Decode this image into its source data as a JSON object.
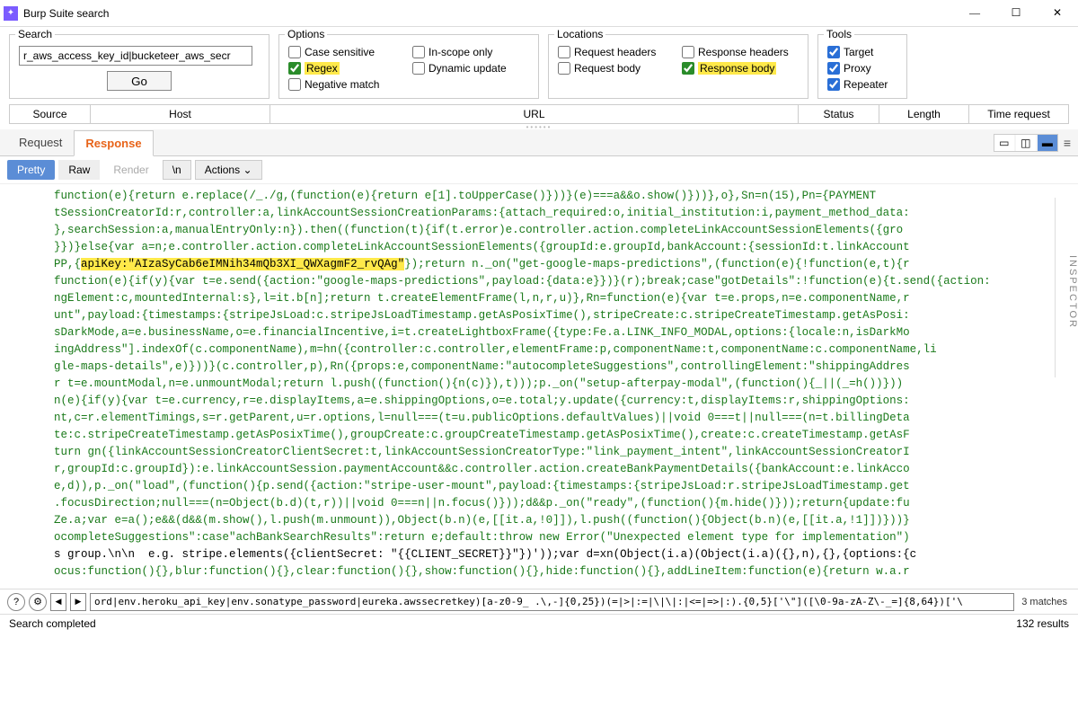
{
  "window": {
    "title": "Burp Suite search",
    "icon_glyph": "✦"
  },
  "search": {
    "legend": "Search",
    "value": "r_aws_access_key_id|bucketeer_aws_secr",
    "go_label": "Go"
  },
  "options": {
    "legend": "Options",
    "case_sensitive": "Case sensitive",
    "regex": "Regex",
    "negative_match": "Negative match",
    "in_scope_only": "In-scope only",
    "dynamic_update": "Dynamic update",
    "checked": {
      "case_sensitive": false,
      "regex": true,
      "negative_match": false,
      "in_scope_only": false,
      "dynamic_update": false
    }
  },
  "locations": {
    "legend": "Locations",
    "request_headers": "Request headers",
    "request_body": "Request body",
    "response_headers": "Response headers",
    "response_body": "Response body",
    "checked": {
      "request_headers": false,
      "request_body": false,
      "response_headers": false,
      "response_body": true
    }
  },
  "tools": {
    "legend": "Tools",
    "target": "Target",
    "proxy": "Proxy",
    "repeater": "Repeater",
    "checked": {
      "target": true,
      "proxy": true,
      "repeater": true
    }
  },
  "columns": {
    "source": "Source",
    "host": "Host",
    "url": "URL",
    "status": "Status",
    "length": "Length",
    "time": "Time request"
  },
  "tabs": {
    "request": "Request",
    "response": "Response"
  },
  "viewer": {
    "pretty": "Pretty",
    "raw": "Raw",
    "render": "Render",
    "newline": "\\n",
    "actions": "Actions"
  },
  "inspector_label": "INSPECTOR",
  "code": {
    "l1": "function(e){return e.replace(/_./g,(function(e){return e[1].toUpperCase()}))}(e)===a&&o.show()}))},o},Sn=n(15),Pn={PAYMENT",
    "l2": "tSessionCreatorId:r,controller:a,linkAccountSessionCreationParams:{attach_required:o,initial_institution:i,payment_method_data:",
    "l3": "},searchSession:a,manualEntryOnly:n}).then((function(t){if(t.error)e.controller.action.completeLinkAccountSessionElements({gro",
    "l4": "}})}else{var a=n;e.controller.action.completeLinkAccountSessionElements({groupId:e.groupId,bankAccount:{sessionId:t.linkAccount",
    "l5a": "PP,{",
    "l5hl": "apiKey:\"AIzaSyCab6eIMNih34mQb3XI_QWXagmF2_rvQAg\"",
    "l5b": "});return n._on(\"get-google-maps-predictions\",(function(e){!function(e,t){r",
    "l6": "function(e){if(y){var t=e.send({action:\"google-maps-predictions\",payload:{data:e}})}(r);break;case\"gotDetails\":!function(e){t.send({action:",
    "l7": "ngElement:c,mountedInternal:s},l=it.b[n];return t.createElementFrame(l,n,r,u)},Rn=function(e){var t=e.props,n=e.componentName,r",
    "l8": "unt\",payload:{timestamps:{stripeJsLoad:c.stripeJsLoadTimestamp.getAsPosixTime(),stripeCreate:c.stripeCreateTimestamp.getAsPosi:",
    "l9": "sDarkMode,a=e.businessName,o=e.financialIncentive,i=t.createLightboxFrame({type:Fe.a.LINK_INFO_MODAL,options:{locale:n,isDarkMo",
    "l10": "ingAddress\"].indexOf(c.componentName),m=hn({controller:c.controller,elementFrame:p,componentName:t,componentName:c.componentName,li",
    "l11": "gle-maps-details\",e)}))}(c.controller,p),Rn({props:e,componentName:\"autocompleteSuggestions\",controllingElement:\"shippingAddres",
    "l12": "r t=e.mountModal,n=e.unmountModal;return l.push((function(){n(c)}),t)));p._on(\"setup-afterpay-modal\",(function(){_||(_=h())}))",
    "l13": "n(e){if(y){var t=e.currency,r=e.displayItems,a=e.shippingOptions,o=e.total;y.update({currency:t,displayItems:r,shippingOptions:",
    "l14": "nt,c=r.elementTimings,s=r.getParent,u=r.options,l=null===(t=u.publicOptions.defaultValues)||void 0===t||null===(n=t.billingDeta",
    "l15": "te:c.stripeCreateTimestamp.getAsPosixTime(),groupCreate:c.groupCreateTimestamp.getAsPosixTime(),create:c.createTimestamp.getAsF",
    "l16": "turn gn({linkAccountSessionCreatorClientSecret:t,linkAccountSessionCreatorType:\"link_payment_intent\",linkAccountSessionCreatorI",
    "l17": "r,groupId:c.groupId}):e.linkAccountSession.paymentAccount&&c.controller.action.createBankPaymentDetails({bankAccount:e.linkAcco",
    "l18": "e,d)),p._on(\"load\",(function(){p.send({action:\"stripe-user-mount\",payload:{timestamps:{stripeJsLoad:r.stripeJsLoadTimestamp.get",
    "l19": ".focusDirection;null===(n=Object(b.d)(t,r))||void 0===n||n.focus()}));d&&p._on(\"ready\",(function(){m.hide()}));return{update:fu",
    "l20": "Ze.a;var e=a();e&&(d&&(m.show(),l.push(m.unmount)),Object(b.n)(e,[[it.a,!0]]),l.push((function(){Object(b.n)(e,[[it.a,!1]])}))}",
    "l21": "ocompleteSuggestions\":case\"achBankSearchResults\":return e;default:throw new Error(\"Unexpected element type for implementation\")",
    "l22": "s group.\\n\\n  e.g. stripe.elements({clientSecret: \"{{CLIENT_SECRET}}\"})'));var d=xn(Object(i.a)(Object(i.a)({},n),{},{options:{c",
    "l23": "ocus:function(){},blur:function(){},clear:function(){},show:function(){},hide:function(){},addLineItem:function(e){return w.a.r"
  },
  "bottom": {
    "regex": "ord|env.heroku_api_key|env.sonatype_password|eureka.awssecretkey)[a-z0-9_ .\\,-]{0,25})(=|>|:=|\\|\\|:|<=|=>|:).{0,5}['\\\"]([\\0-9a-zA-Z\\-_=]{8,64})['\\",
    "matches": "3 matches"
  },
  "status": {
    "left": "Search completed",
    "right": "132 results"
  }
}
